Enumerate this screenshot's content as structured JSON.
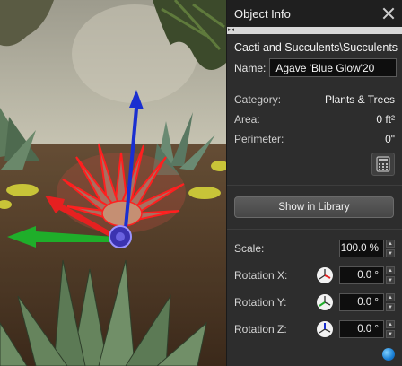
{
  "panel": {
    "title": "Object Info",
    "path": "Cacti and Succulents\\Succulents",
    "name_label": "Name:",
    "name_value": "Agave 'Blue Glow'20",
    "properties": [
      {
        "label": "Category:",
        "value": "Plants & Trees"
      },
      {
        "label": "Area:",
        "value": "0 ft²"
      },
      {
        "label": "Perimeter:",
        "value": "0\""
      }
    ],
    "library_button": "Show in Library",
    "scale": {
      "label": "Scale:",
      "value": "100.0 %"
    },
    "rotation_x": {
      "label": "Rotation X:",
      "value": "0.0 °"
    },
    "rotation_y": {
      "label": "Rotation Y:",
      "value": "0.0 °"
    },
    "rotation_z": {
      "label": "Rotation Z:",
      "value": "0.0 °"
    }
  },
  "icons": {
    "close": "close-icon",
    "pin": "pin-icon",
    "calculator": "calculator-icon",
    "rotate_x": "rotate-x-icon",
    "rotate_y": "rotate-y-icon",
    "rotate_z": "rotate-z-icon",
    "help": "help-icon"
  },
  "colors": {
    "panel_bg": "#2d2d2d",
    "header_bg": "#1f1f1f",
    "gizmo_x": "#e62020",
    "gizmo_y": "#1fae2a",
    "gizmo_z": "#1a2fd0",
    "selection_highlight": "#ff2020"
  }
}
